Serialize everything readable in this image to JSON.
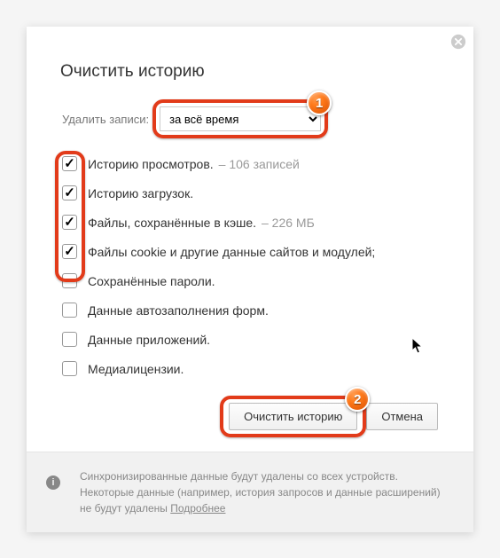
{
  "title": "Очистить историю",
  "select": {
    "label": "Удалить записи:",
    "value": "за всё время"
  },
  "badges": {
    "one": "1",
    "two": "2"
  },
  "options": [
    {
      "checked": true,
      "label": "Историю просмотров.",
      "detail": "–  106 записей"
    },
    {
      "checked": true,
      "label": "Историю загрузок.",
      "detail": ""
    },
    {
      "checked": true,
      "label": "Файлы, сохранённые в кэше.",
      "detail": "–  226 МБ"
    },
    {
      "checked": true,
      "label": "Файлы cookie и другие данные сайтов и модулей;",
      "detail": ""
    },
    {
      "checked": false,
      "label": "Сохранённые пароли.",
      "detail": ""
    },
    {
      "checked": false,
      "label": "Данные автозаполнения форм.",
      "detail": ""
    },
    {
      "checked": false,
      "label": "Данные приложений.",
      "detail": ""
    },
    {
      "checked": false,
      "label": "Медиалицензии.",
      "detail": ""
    }
  ],
  "buttons": {
    "clear": "Очистить историю",
    "cancel": "Отмена"
  },
  "footer": {
    "text": "Синхронизированные данные будут удалены со всех устройств. Некоторые данные (например, история запросов и данные расширений) не будут удалены ",
    "link": "Подробнее"
  }
}
